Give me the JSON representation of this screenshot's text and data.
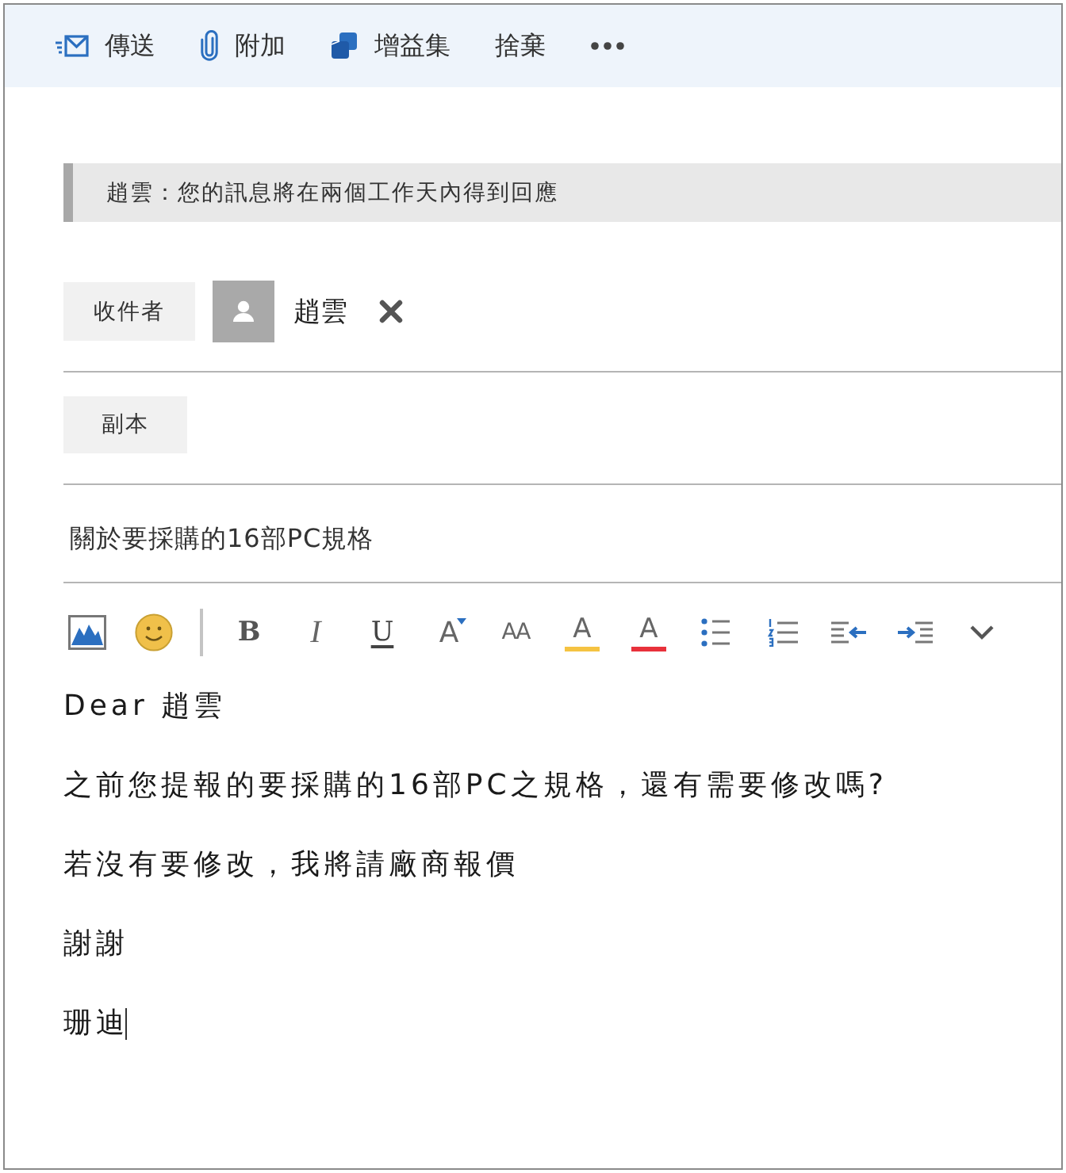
{
  "toolbar": {
    "items": [
      {
        "kind": "send",
        "label": "傳送"
      },
      {
        "kind": "attach",
        "label": "附加"
      },
      {
        "kind": "addins",
        "label": "增益集"
      },
      {
        "kind": "plain",
        "label": "捨棄"
      },
      {
        "kind": "more"
      }
    ]
  },
  "notice": {
    "text": "趙雲：您的訊息將在兩個工作天內得到回應"
  },
  "to": {
    "label": "收件者",
    "recipients": [
      {
        "name": "趙雲"
      }
    ]
  },
  "cc": {
    "label": "副本"
  },
  "subject": {
    "value": "關於要採購的16部PC規格"
  },
  "format_toolbar": {
    "items": [
      {
        "kind": "picture"
      },
      {
        "kind": "emoji"
      },
      {
        "kind": "separator"
      },
      {
        "kind": "bold",
        "label": "B"
      },
      {
        "kind": "italic",
        "label": "I"
      },
      {
        "kind": "underline",
        "label": "U"
      },
      {
        "kind": "grow_font",
        "label": "A"
      },
      {
        "kind": "shrink_font",
        "label": "AA"
      },
      {
        "kind": "highlight",
        "label": "A",
        "color": "#f5c342"
      },
      {
        "kind": "font_color",
        "label": "A",
        "color": "#e8313b"
      },
      {
        "kind": "bullets"
      },
      {
        "kind": "numbering"
      },
      {
        "kind": "outdent"
      },
      {
        "kind": "indent"
      },
      {
        "kind": "more"
      }
    ]
  },
  "body": {
    "paragraphs": [
      "Dear 趙雲",
      "之前您提報的要採購的16部PC之規格，還有需要修改嗎?",
      "若沒有要修改，我將請廠商報價",
      "謝謝",
      "珊迪"
    ],
    "caret": true
  }
}
